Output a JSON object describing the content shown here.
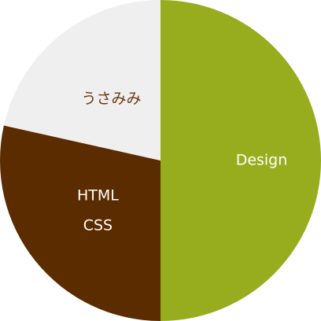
{
  "chart_data": {
    "type": "pie",
    "start": "12 o'clock",
    "direction": "clockwise",
    "slices": [
      {
        "labels": [
          "Design"
        ],
        "value": 50,
        "color": "#98ad1e",
        "label_color": "#ffffff"
      },
      {
        "labels": [
          "HTML",
          "CSS"
        ],
        "value": 28.5,
        "color": "#5b2c00",
        "label_color": "#ffffff"
      },
      {
        "labels": [
          "うさみみ"
        ],
        "value": 21.5,
        "color": "#efefef",
        "label_color": "#6b3a12"
      }
    ]
  }
}
